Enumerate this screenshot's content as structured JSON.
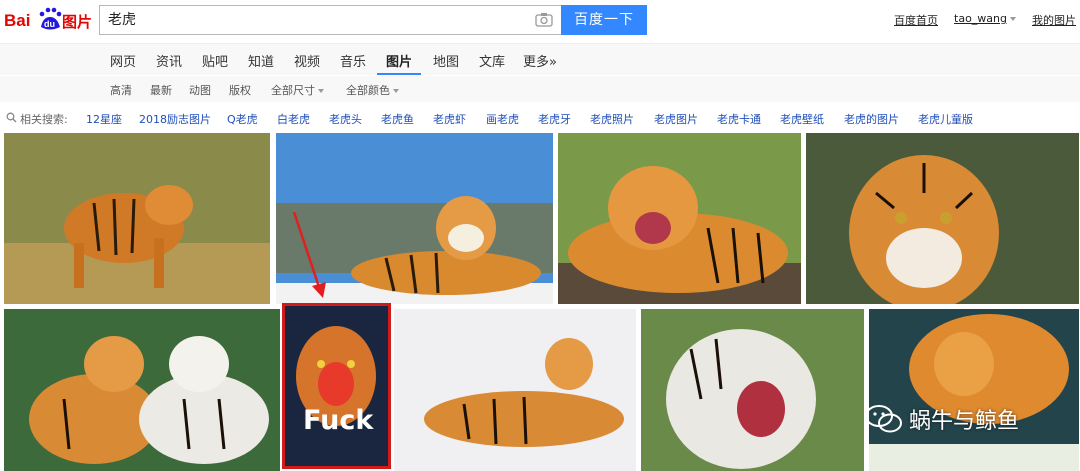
{
  "header": {
    "logo_text": "Bai du 图片",
    "search_value": "老虎",
    "search_button": "百度一下",
    "links": [
      "百度首页"
    ],
    "user": "tao_wang",
    "my_images": "我的图片"
  },
  "nav": {
    "items": [
      "网页",
      "资讯",
      "贴吧",
      "知道",
      "视频",
      "音乐",
      "图片",
      "地图",
      "文库",
      "更多»"
    ],
    "active": "图片"
  },
  "filters": [
    "高清",
    "最新",
    "动图",
    "版权",
    "全部尺寸",
    "全部颜色"
  ],
  "related": {
    "label": "相关搜索:",
    "tags": [
      "12星座",
      "2018励志图片",
      "Q老虎",
      "白老虎",
      "老虎头",
      "老虎鱼",
      "老虎虾",
      "画老虎",
      "老虎牙",
      "老虎照片",
      "老虎图片",
      "老虎卡通",
      "老虎壁纸",
      "老虎的图片",
      "老虎儿童版"
    ]
  },
  "results": {
    "overlay_text": "Fuck",
    "watermark": "蜗牛与鲸鱼"
  },
  "colors": {
    "accent": "#3388ff",
    "link": "#1f4fb8",
    "highlight": "#d11b1b"
  }
}
